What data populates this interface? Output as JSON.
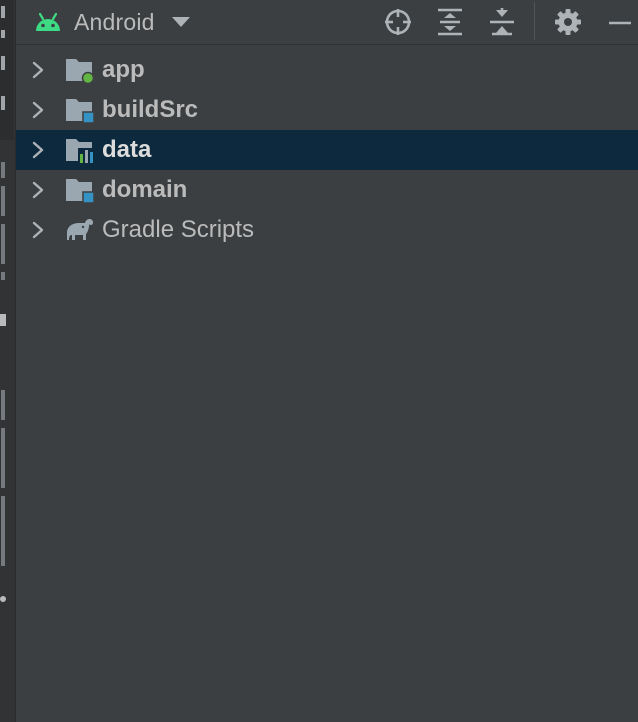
{
  "header": {
    "view_mode": "Android",
    "icons": {
      "view": "android-icon",
      "dropdown": "chevron-down-icon",
      "locate": "crosshair-icon",
      "expand": "expand-all-icon",
      "collapse": "collapse-all-icon",
      "settings": "gear-icon",
      "hide": "minimize-icon"
    }
  },
  "tree": {
    "items": [
      {
        "label": "app",
        "icon": "app-module-icon",
        "bold": true,
        "selected": false
      },
      {
        "label": "buildSrc",
        "icon": "module-folder-icon",
        "bold": true,
        "selected": false
      },
      {
        "label": "data",
        "icon": "library-module-icon",
        "bold": true,
        "selected": true
      },
      {
        "label": "domain",
        "icon": "module-folder-icon",
        "bold": true,
        "selected": false
      },
      {
        "label": "Gradle Scripts",
        "icon": "gradle-elephant-icon",
        "bold": false,
        "selected": false
      }
    ]
  },
  "colors": {
    "background": "#3c3f41",
    "selection": "#0d293e",
    "text": "#bbbbbb",
    "android_green": "#3ddc84",
    "module_blue": "#3592c4",
    "app_green": "#62b543",
    "folder_gray": "#9aa7b0"
  }
}
